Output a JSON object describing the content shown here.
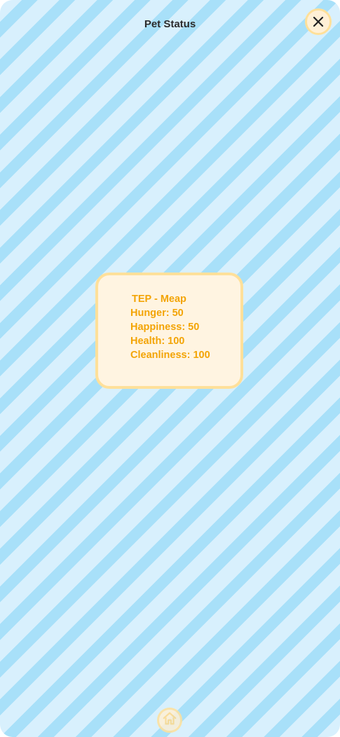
{
  "header": {
    "title": "Pet Status",
    "close_icon": "close-icon"
  },
  "pet_card": {
    "name_line": "TEP - Meap",
    "stats": [
      "Hunger: 50",
      "Happiness: 50",
      "Health: 100",
      "Cleanliness: 100"
    ]
  },
  "footer": {
    "home_icon": "home-icon"
  },
  "colors": {
    "stripe_light": "#d8f0fd",
    "stripe_dark": "#a8e0f9",
    "card_bg": "#fff4e1",
    "card_border": "#ffe09a",
    "stat_text": "#f3a405"
  }
}
